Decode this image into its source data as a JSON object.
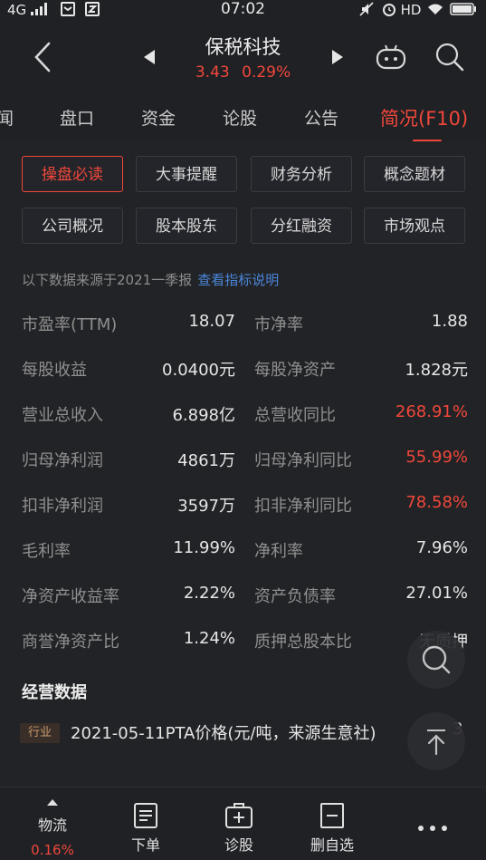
{
  "status_bar": {
    "network": "4G",
    "time": "07:02",
    "hd": "HD"
  },
  "header": {
    "stock_name": "保税科技",
    "price": "3.43",
    "change_pct": "0.29%"
  },
  "tabs": [
    {
      "label": "闻"
    },
    {
      "label": "盘口"
    },
    {
      "label": "资金"
    },
    {
      "label": "论股"
    },
    {
      "label": "公告"
    },
    {
      "label": "简况(F10)",
      "active": true
    }
  ],
  "grid_buttons": [
    {
      "label": "操盘必读",
      "active": true
    },
    {
      "label": "大事提醒"
    },
    {
      "label": "财务分析"
    },
    {
      "label": "概念题材"
    },
    {
      "label": "公司概况"
    },
    {
      "label": "股本股东"
    },
    {
      "label": "分红融资"
    },
    {
      "label": "市场观点"
    }
  ],
  "data_note": {
    "text": "以下数据来源于2021一季报",
    "link": "查看指标说明"
  },
  "metrics": [
    {
      "l1": "市盈率(TTM)",
      "v1": "18.07",
      "l2": "市净率",
      "v2": "1.88"
    },
    {
      "l1": "每股收益",
      "v1": "0.0400元",
      "l2": "每股净资产",
      "v2": "1.828元"
    },
    {
      "l1": "营业总收入",
      "v1": "6.898亿",
      "l2": "总营收同比",
      "v2": "268.91%"
    },
    {
      "l1": "归母净利润",
      "v1": "4861万",
      "l2": "归母净利同比",
      "v2": "55.99%"
    },
    {
      "l1": "扣非净利润",
      "v1": "3597万",
      "l2": "扣非净利同比",
      "v2": "78.58%"
    },
    {
      "l1": "毛利率",
      "v1": "11.99%",
      "l2": "净利率",
      "v2": "7.96%"
    },
    {
      "l1": "净资产收益率",
      "v1": "2.22%",
      "l2": "资产负债率",
      "v2": "27.01%"
    },
    {
      "l1": "商誉净资产比",
      "v1": "1.24%",
      "l2": "质押总股本比",
      "v2": "无质押"
    }
  ],
  "operations": {
    "title": "经营数据",
    "tag": "行业",
    "item_text": "2021-05-11PTA价格(元/吨，来源生意社)",
    "item_extra": "3"
  },
  "bottom_nav": [
    {
      "label": "物流",
      "sub": "0.16%"
    },
    {
      "label": "下单"
    },
    {
      "label": "诊股"
    },
    {
      "label": "删自选"
    }
  ],
  "colors": {
    "accent_red": "#f0473b",
    "link_blue": "#4a86d9",
    "background": "#202125"
  }
}
